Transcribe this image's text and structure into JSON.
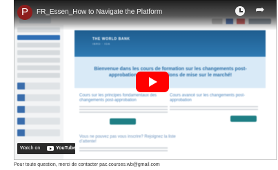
{
  "video": {
    "channel_initial": "P",
    "title": "FR_Essen_How to Navigate the Platform",
    "watch_label": "Watch on",
    "watch_brand": "YouTube",
    "clock_icon": "watch-later-icon",
    "share_icon": "share-icon",
    "play_icon": "play-icon"
  },
  "slide": {
    "banner_text": "Bienvenue dans les cours de formation sur les changements post-approbation des autorisations de mise sur le marché!",
    "left_card_title": "Cours sur les principes fondamentaux des changements post-approbation",
    "right_card_title": "Cours avancé sur les changements post-approbation",
    "lower_title": "Vous ne pouvez pas vous inscrire? Rejoignez la liste d’attente!"
  },
  "footer_text": "Pour toute question, merci de contacter pac.courses.wb@gmail.com",
  "colors": {
    "youtube_red": "#ff0000",
    "slide_blue": "#2b6fa7",
    "avatar": "#8d1d1d"
  }
}
